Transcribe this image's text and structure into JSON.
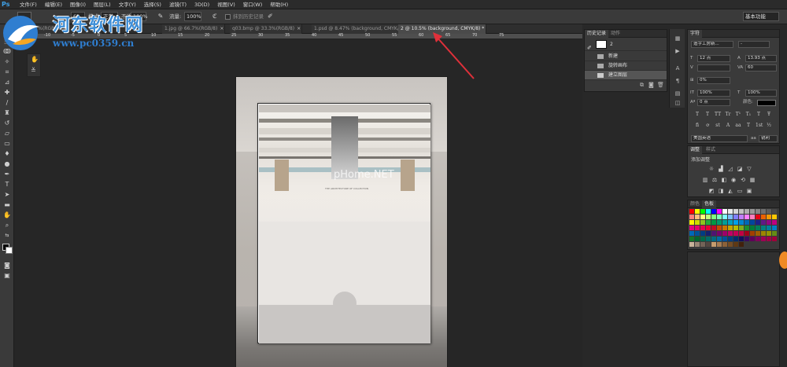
{
  "app": {
    "logo": "Ps"
  },
  "menu": [
    "文件(F)",
    "编辑(E)",
    "图像(I)",
    "图层(L)",
    "文字(Y)",
    "选择(S)",
    "滤镜(T)",
    "3D(D)",
    "视图(V)",
    "窗口(W)",
    "帮助(H)"
  ],
  "options": {
    "brush_size": "69",
    "mode_label": "模式:",
    "mode_value": "正常",
    "opacity_label": "不透明度:",
    "opacity_value": "100%",
    "flow_label": "流量:",
    "flow_value": "100%",
    "history_label": "抹到历史记录",
    "workspace": "基本功能"
  },
  "tabs": [
    {
      "label": "…@ 66.7%(RGB/8)",
      "active": false
    },
    {
      "label": "1.jpg @ 66.7%(RGB/8)",
      "active": false
    },
    {
      "label": "q03.bmp @ 33.3%(RGB/8)",
      "active": false
    },
    {
      "label": "1.psd @ 8.47% (background, CMYK/8)",
      "active": false
    },
    {
      "label": "2 @ 10.5% (background, CMYK/8) *",
      "active": true
    }
  ],
  "ruler_ticks": [
    "-15",
    "-10",
    "-5",
    "0",
    "5",
    "10",
    "15",
    "20",
    "25",
    "30",
    "35",
    "40",
    "45",
    "50",
    "55",
    "60",
    "65",
    "70",
    "75"
  ],
  "history_panel": {
    "tabs": [
      "历史记录",
      "动作"
    ],
    "snapshot": "2",
    "steps": [
      "新建",
      "旋转画布",
      "建立图层"
    ]
  },
  "character_panel": {
    "tabs": [
      "字符"
    ],
    "font_family": "造字工房新...",
    "font_style": "-",
    "font_size": "12 点",
    "leading": "13.93 点",
    "kerning": "",
    "tracking": "60",
    "scale_percent": "0%",
    "vertical_scale": "100%",
    "horizontal_scale": "100%",
    "baseline": "0 点",
    "color_label": "颜色:",
    "language": "美国英语",
    "antialias": "锐利",
    "type_buttons": [
      "T",
      "T",
      "TT",
      "Tr",
      "T¹",
      "T₁",
      "T",
      "Ŧ"
    ],
    "ot_buttons": [
      "fi",
      "ơ",
      "st",
      "A",
      "aa",
      "T",
      "1st",
      "½"
    ]
  },
  "adjustments_panel": {
    "tabs": [
      "调整",
      "样式"
    ],
    "heading": "添加调整"
  },
  "swatches_panel": {
    "tabs": [
      "颜色",
      "色板"
    ]
  },
  "colors": {
    "accent": "#3fa0e6",
    "arrow": "#e0303a",
    "badge": "#f08a24",
    "swatches": [
      "#ff0000",
      "#ffff00",
      "#00ff00",
      "#00ffff",
      "#0000ff",
      "#ff00ff",
      "#ffffff",
      "#ebebeb",
      "#d6d6d6",
      "#c2c2c2",
      "#adadad",
      "#999999",
      "#858585",
      "#707070",
      "#5c5c5c",
      "#474747",
      "#ff7f7f",
      "#ffbf7f",
      "#ffff7f",
      "#bfff7f",
      "#7fff7f",
      "#7fffbf",
      "#7fffff",
      "#7fbfff",
      "#7f7fff",
      "#bf7fff",
      "#ff7fff",
      "#ff7fbf",
      "#e60012",
      "#eb6100",
      "#f39800",
      "#fcc800",
      "#fff100",
      "#cfdb00",
      "#8fc31f",
      "#22ac38",
      "#009944",
      "#009b6b",
      "#009e96",
      "#00a0c1",
      "#00a0e9",
      "#0086d1",
      "#0068b7",
      "#00479d",
      "#1d2088",
      "#601986",
      "#920783",
      "#be0081",
      "#e4007f",
      "#e5006a",
      "#e5004f",
      "#e60033",
      "#c30d23",
      "#c44c00",
      "#c97600",
      "#c4a600",
      "#b8ba00",
      "#7eab1d",
      "#1c8e2f",
      "#007d39",
      "#007f59",
      "#008080",
      "#007f9c",
      "#0080c6",
      "#0068b7",
      "#005299",
      "#003c82",
      "#16206e",
      "#4e1472",
      "#77046c",
      "#9e006a",
      "#c10066",
      "#c20055",
      "#c20044",
      "#a00019",
      "#a33e00",
      "#a25f00",
      "#9d8500",
      "#959600",
      "#668c15",
      "#177529",
      "#00662f",
      "#006849",
      "#006a69",
      "#006980",
      "#0069a4",
      "#004f99",
      "#003e7e",
      "#002d6b",
      "#110e5b",
      "#3c0a5e",
      "#5f005a",
      "#800059",
      "#9e0054",
      "#9f0046",
      "#a0003a",
      "#c7b299",
      "#998675",
      "#736357",
      "#534741",
      "#c69c6d",
      "#a67c52",
      "#8c6239",
      "#754c24",
      "#603913",
      "#42210b"
    ]
  },
  "watermark": {
    "site_title": "河东软件网",
    "site_url": "www.pc0359.cn",
    "image_watermark": "pHome.NET",
    "photo_caption": "THE ARCHITECTURE OF COLLECTION"
  }
}
